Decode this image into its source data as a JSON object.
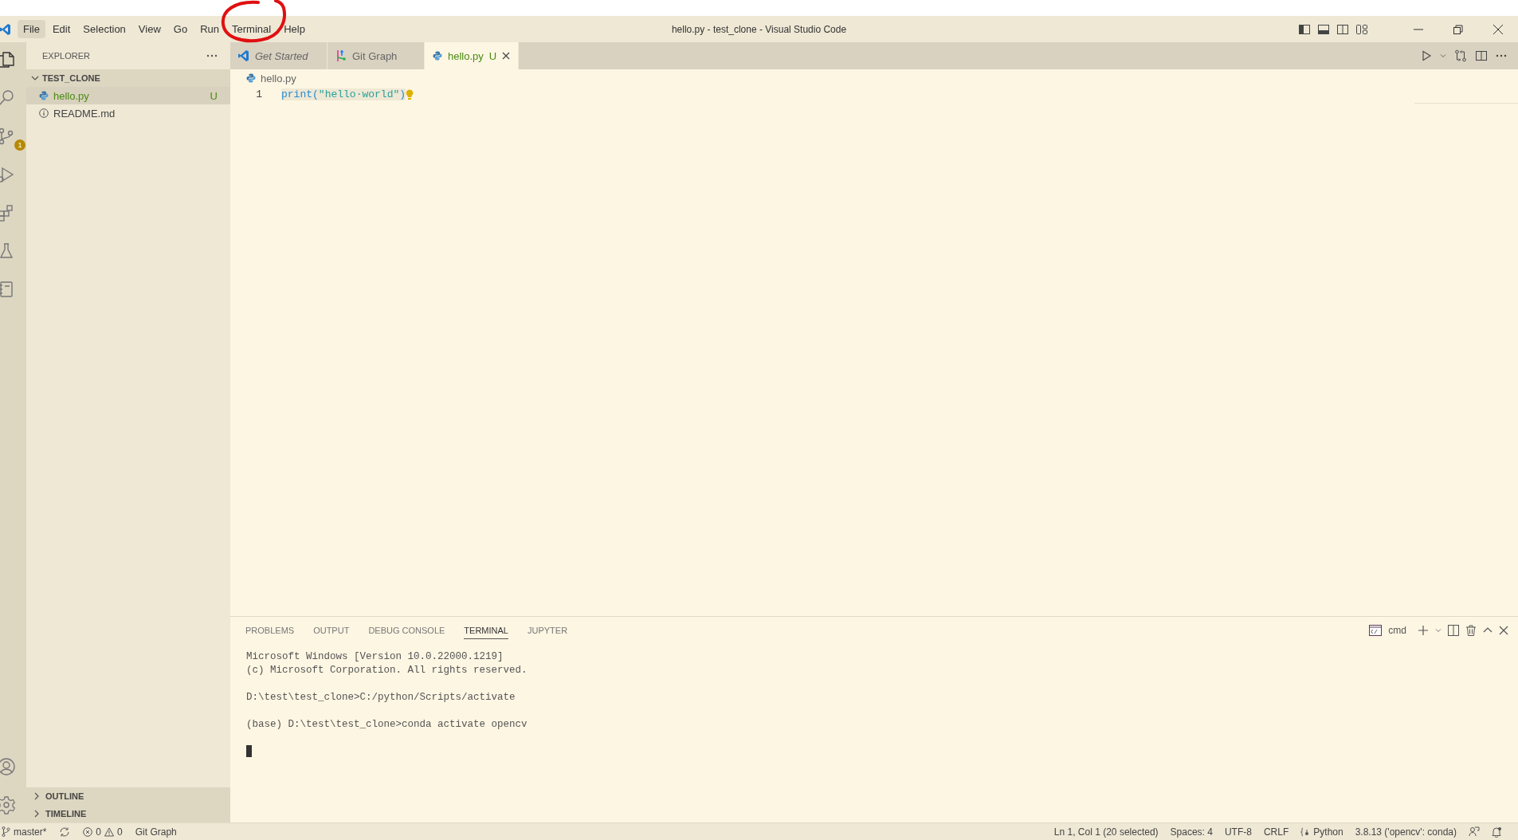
{
  "window": {
    "title": "hello.py - test_clone - Visual Studio Code"
  },
  "menu": [
    {
      "label": "File",
      "selected": true
    },
    {
      "label": "Edit",
      "selected": false
    },
    {
      "label": "Selection",
      "selected": false
    },
    {
      "label": "View",
      "selected": false
    },
    {
      "label": "Go",
      "selected": false
    },
    {
      "label": "Run",
      "selected": false
    },
    {
      "label": "Terminal",
      "selected": false
    },
    {
      "label": "Help",
      "selected": false
    }
  ],
  "activity_bar": {
    "source_control_badge": "1"
  },
  "sidebar": {
    "title": "EXPLORER",
    "folder": {
      "name": "TEST_CLONE",
      "expanded": true,
      "children": [
        {
          "name": "hello.py",
          "kind": "python",
          "selected": true,
          "status": "U"
        },
        {
          "name": "README.md",
          "kind": "info",
          "selected": false
        }
      ]
    },
    "sections": [
      {
        "name": "OUTLINE",
        "expanded": false
      },
      {
        "name": "TIMELINE",
        "expanded": false
      }
    ]
  },
  "tabs": [
    {
      "label": "Get Started",
      "kind": "vscode",
      "preview": true,
      "selected": false
    },
    {
      "label": "Git Graph",
      "kind": "gitgraph",
      "preview": false,
      "selected": false
    },
    {
      "label": "hello.py",
      "kind": "python",
      "preview": false,
      "status": "U",
      "selected": true
    }
  ],
  "breadcrumb": "hello.py",
  "editor": {
    "lines": [
      {
        "number": "1",
        "selected": true,
        "tokens": [
          {
            "kind": "function",
            "text": "print"
          },
          {
            "kind": "punct",
            "text": "("
          },
          {
            "kind": "string",
            "text": "\"hello·world\""
          },
          {
            "kind": "punct",
            "text": ")"
          }
        ]
      }
    ]
  },
  "panel": {
    "tabs": [
      {
        "label": "PROBLEMS",
        "selected": false
      },
      {
        "label": "OUTPUT",
        "selected": false
      },
      {
        "label": "DEBUG CONSOLE",
        "selected": false
      },
      {
        "label": "TERMINAL",
        "selected": true
      },
      {
        "label": "JUPYTER",
        "selected": false
      }
    ],
    "terminal_profile": "cmd",
    "terminal_blocks": [
      [
        "Microsoft Windows [Version 10.0.22000.1219]",
        "(c) Microsoft Corporation. All rights reserved."
      ],
      [
        "D:\\test\\test_clone>C:/python/Scripts/activate"
      ],
      [
        "(base) D:\\test\\test_clone>conda activate opencv"
      ]
    ]
  },
  "status_bar": {
    "branch": "master*",
    "errors": "0",
    "warnings": "0",
    "left_items": [
      "Git Graph"
    ],
    "right_items": [
      "Ln 1, Col 1 (20 selected)",
      "Spaces: 4",
      "UTF-8",
      "CRLF"
    ],
    "language": "Python",
    "interpreter": "3.8.13 ('opencv': conda)"
  }
}
